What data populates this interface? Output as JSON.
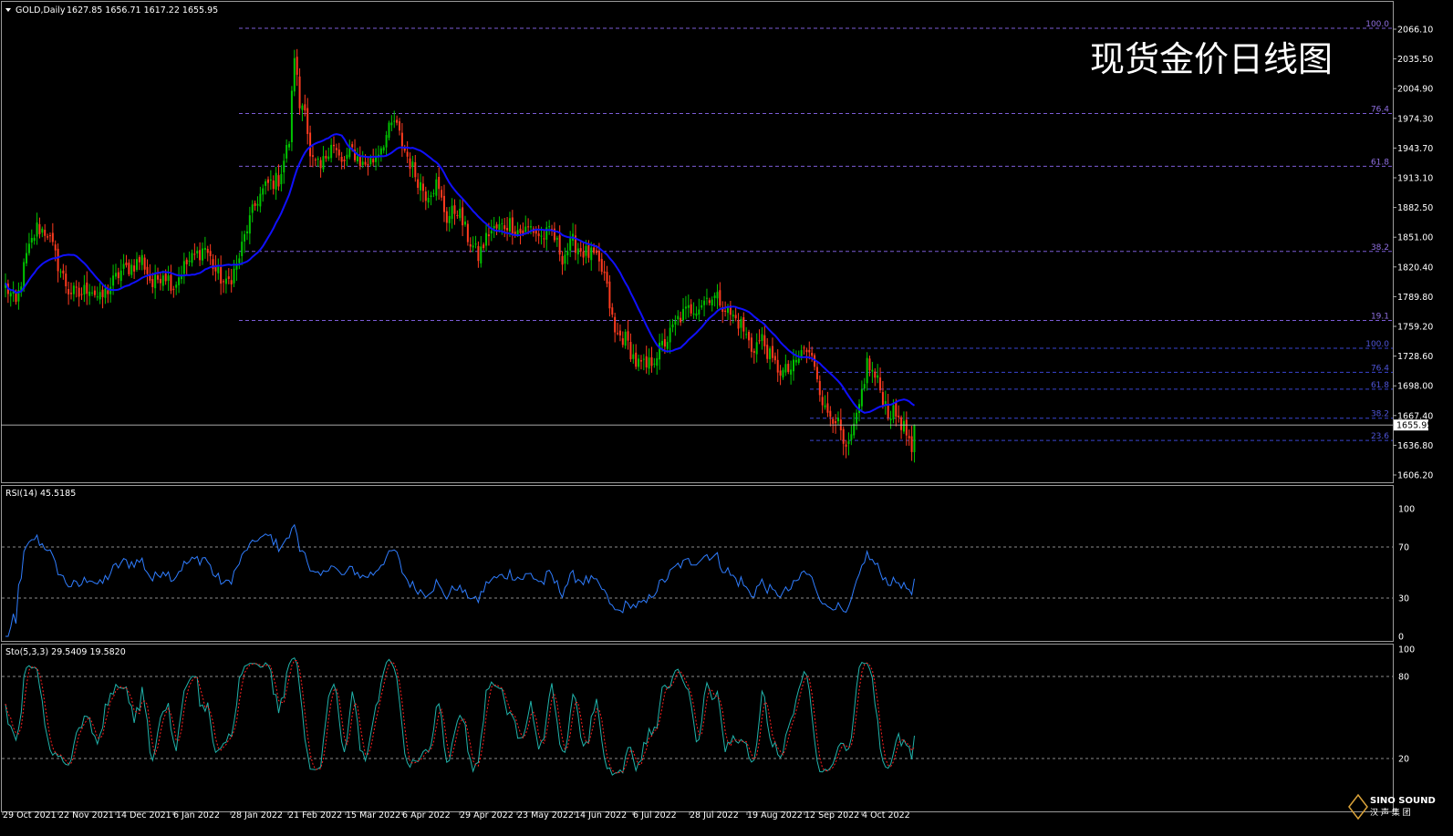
{
  "header": {
    "symbol": "GOLD,Daily",
    "ohlc": "1627.85 1656.71 1617.22 1655.95",
    "watermark_title": "现货金价日线图"
  },
  "price_axis": {
    "labels": [
      "2066.10",
      "2035.50",
      "2004.90",
      "1974.30",
      "1943.70",
      "1913.10",
      "1882.50",
      "1851.00",
      "1820.40",
      "1789.80",
      "1759.20",
      "1728.60",
      "1698.00",
      "1667.40",
      "1636.80",
      "1606.20"
    ],
    "current_price_label": "1655.95"
  },
  "fibonacci_primary": {
    "levels": [
      "100.0",
      "76.4",
      "61.8",
      "38.2",
      "19.1"
    ]
  },
  "fibonacci_secondary": {
    "levels": [
      "100.0",
      "76.4",
      "61.8",
      "38.2",
      "23.6"
    ]
  },
  "rsi_panel": {
    "label": "RSI(14) 45.5185",
    "axis": [
      "100",
      "70",
      "30",
      "0"
    ]
  },
  "stoch_panel": {
    "label": "Sto(5,3,3) 29.5409 19.5820",
    "axis": [
      "100",
      "80",
      "20"
    ]
  },
  "date_axis": {
    "labels": [
      "29 Oct 2021",
      "22 Nov 2021",
      "14 Dec 2021",
      "6 Jan 2022",
      "28 Jan 2022",
      "21 Feb 2022",
      "15 Mar 2022",
      "6 Apr 2022",
      "29 Apr 2022",
      "23 May 2022",
      "14 Jun 2022",
      "6 Jul 2022",
      "28 Jul 2022",
      "19 Aug 2022",
      "12 Sep 2022",
      "4 Oct 2022"
    ]
  },
  "logo": {
    "line1": "SINO SOUND",
    "line2": "汉 声 集 团"
  },
  "colors": {
    "bull_candle": "#00c400",
    "bear_candle": "#ff3b1f",
    "ma_line": "#1010ff",
    "rsi_line": "#2f7dff",
    "stoch_main": "#20b2aa",
    "stoch_signal": "#ff2020",
    "fibo_primary": "#7b5cd6",
    "fibo_secondary": "#3a45d0"
  },
  "chart_data": [
    {
      "type": "candlestick",
      "title": "GOLD,Daily",
      "series_anchors": {
        "close": [
          [
            0,
            1800
          ],
          [
            4,
            1780
          ],
          [
            8,
            1830
          ],
          [
            12,
            1860
          ],
          [
            16,
            1855
          ],
          [
            20,
            1822
          ],
          [
            24,
            1795
          ],
          [
            28,
            1790
          ],
          [
            32,
            1800
          ],
          [
            36,
            1785
          ],
          [
            40,
            1800
          ],
          [
            44,
            1815
          ],
          [
            48,
            1820
          ],
          [
            52,
            1828
          ],
          [
            56,
            1800
          ],
          [
            60,
            1815
          ],
          [
            64,
            1800
          ],
          [
            68,
            1820
          ],
          [
            72,
            1830
          ],
          [
            76,
            1840
          ],
          [
            80,
            1815
          ],
          [
            84,
            1800
          ],
          [
            88,
            1820
          ],
          [
            92,
            1860
          ],
          [
            96,
            1890
          ],
          [
            100,
            1905
          ],
          [
            104,
            1910
          ],
          [
            108,
            1950
          ],
          [
            110,
            2040
          ],
          [
            112,
            1985
          ],
          [
            114,
            1990
          ],
          [
            116,
            1930
          ],
          [
            120,
            1920
          ],
          [
            124,
            1950
          ],
          [
            128,
            1925
          ],
          [
            132,
            1940
          ],
          [
            136,
            1925
          ],
          [
            140,
            1930
          ],
          [
            144,
            1950
          ],
          [
            148,
            1970
          ],
          [
            152,
            1940
          ],
          [
            156,
            1915
          ],
          [
            160,
            1895
          ],
          [
            164,
            1905
          ],
          [
            168,
            1870
          ],
          [
            172,
            1880
          ],
          [
            176,
            1850
          ],
          [
            180,
            1830
          ],
          [
            184,
            1855
          ],
          [
            188,
            1860
          ],
          [
            192,
            1865
          ],
          [
            196,
            1855
          ],
          [
            200,
            1860
          ],
          [
            204,
            1850
          ],
          [
            208,
            1855
          ],
          [
            212,
            1830
          ],
          [
            216,
            1845
          ],
          [
            220,
            1835
          ],
          [
            224,
            1830
          ],
          [
            228,
            1810
          ],
          [
            232,
            1750
          ],
          [
            236,
            1745
          ],
          [
            240,
            1720
          ],
          [
            244,
            1715
          ],
          [
            248,
            1730
          ],
          [
            252,
            1745
          ],
          [
            256,
            1765
          ],
          [
            260,
            1775
          ],
          [
            264,
            1780
          ],
          [
            268,
            1790
          ],
          [
            272,
            1785
          ],
          [
            276,
            1770
          ],
          [
            280,
            1760
          ],
          [
            284,
            1735
          ],
          [
            288,
            1745
          ],
          [
            292,
            1720
          ],
          [
            296,
            1710
          ],
          [
            300,
            1715
          ],
          [
            304,
            1735
          ],
          [
            308,
            1720
          ],
          [
            312,
            1670
          ],
          [
            316,
            1665
          ],
          [
            320,
            1625
          ],
          [
            324,
            1660
          ],
          [
            328,
            1720
          ],
          [
            332,
            1700
          ],
          [
            336,
            1670
          ],
          [
            340,
            1665
          ],
          [
            344,
            1640
          ],
          [
            346,
            1656
          ]
        ],
        "total_bars": 347
      },
      "ma_period": 20,
      "current_price": 1655.95,
      "ylim": [
        1606.2,
        2066.1
      ]
    },
    {
      "type": "line",
      "title": "RSI(14) 45.5185",
      "ylim": [
        0,
        100
      ],
      "reference_levels": [
        70,
        30
      ]
    },
    {
      "type": "line",
      "title": "Sto(5,3,3) 29.5409 19.5820",
      "ylim": [
        0,
        100
      ],
      "reference_levels": [
        80,
        20
      ]
    }
  ]
}
